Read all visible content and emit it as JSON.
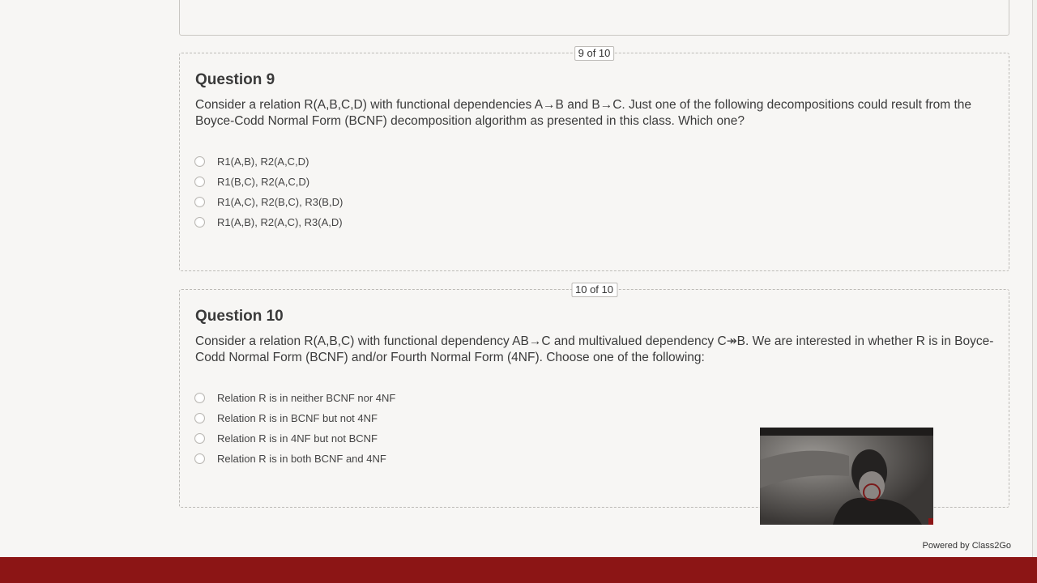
{
  "questions": [
    {
      "counter": "9 of 10",
      "title": "Question 9",
      "text": "Consider a relation R(A,B,C,D) with functional dependencies A→B and B→C. Just one of the following decompositions could result from the Boyce-Codd Normal Form (BCNF) decomposition algorithm as presented in this class. Which one?",
      "options": [
        "R1(A,B), R2(A,C,D)",
        "R1(B,C), R2(A,C,D)",
        "R1(A,C), R2(B,C), R3(B,D)",
        "R1(A,B), R2(A,C), R3(A,D)"
      ]
    },
    {
      "counter": "10 of 10",
      "title": "Question 10",
      "text": "Consider a relation R(A,B,C) with functional dependency AB→C and multivalued dependency C↠B. We are interested in whether R is in Boyce-Codd Normal Form (BCNF) and/or Fourth Normal Form (4NF). Choose one of the following:",
      "options": [
        "Relation R is in neither BCNF nor 4NF",
        "Relation R is in BCNF but not 4NF",
        "Relation R is in 4NF but not BCNF",
        "Relation R is in both BCNF and 4NF"
      ]
    }
  ],
  "footer": {
    "powered_by": "Powered by Class2Go"
  },
  "colors": {
    "page_bg": "#f7f6f4",
    "footer_bar": "#8c1515"
  }
}
